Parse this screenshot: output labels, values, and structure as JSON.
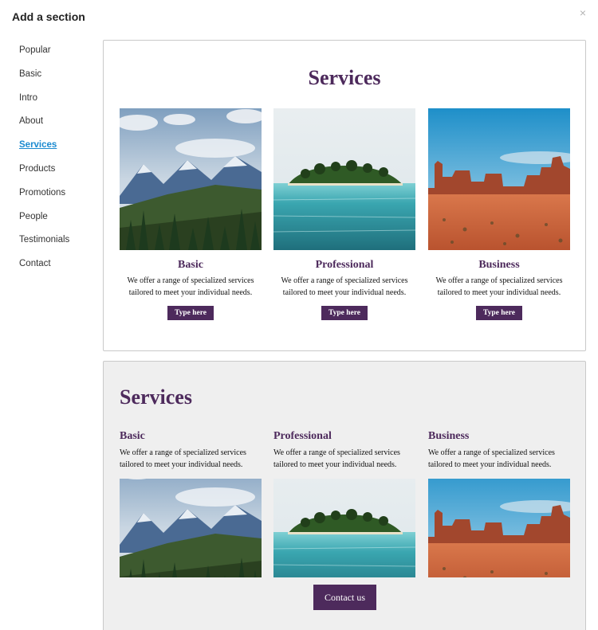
{
  "dialog": {
    "title": "Add a section",
    "close_glyph": "×"
  },
  "sidebar": {
    "items": [
      {
        "label": "Popular"
      },
      {
        "label": "Basic"
      },
      {
        "label": "Intro"
      },
      {
        "label": "About"
      },
      {
        "label": "Services",
        "active": true
      },
      {
        "label": "Products"
      },
      {
        "label": "Promotions"
      },
      {
        "label": "People"
      },
      {
        "label": "Testimonials"
      },
      {
        "label": "Contact"
      }
    ]
  },
  "previews": [
    {
      "title": "Services",
      "columns": [
        {
          "heading": "Basic",
          "text": "We offer a range of specialized services tailored to meet your individual needs.",
          "button": "Type here",
          "image": "mountains-image"
        },
        {
          "heading": "Professional",
          "text": "We offer a range of specialized services tailored to meet your individual needs.",
          "button": "Type here",
          "image": "island-image"
        },
        {
          "heading": "Business",
          "text": "We offer a range of specialized services tailored to meet your individual needs.",
          "button": "Type here",
          "image": "desert-image"
        }
      ]
    },
    {
      "title": "Services",
      "columns": [
        {
          "heading": "Basic",
          "text": "We offer a range of specialized services tailored to meet your individual needs.",
          "image": "mountains-image"
        },
        {
          "heading": "Professional",
          "text": "We offer a range of specialized services tailored to meet your individual needs.",
          "image": "island-image"
        },
        {
          "heading": "Business",
          "text": "We offer a range of specialized services tailored to meet your individual needs.",
          "image": "desert-image"
        }
      ],
      "button": "Contact us"
    }
  ],
  "colors": {
    "accent": "#4d2a5c",
    "active_link": "#1a8ad0",
    "card_border": "#c9c9c9",
    "card2_bg": "#efefef"
  }
}
